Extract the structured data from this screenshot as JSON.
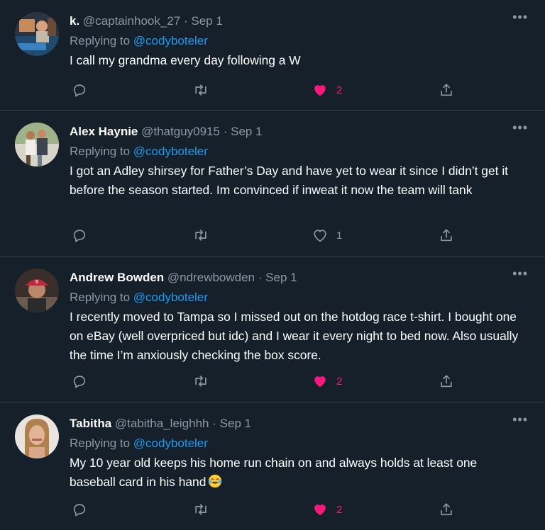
{
  "icons": {
    "reply": "reply-icon",
    "retweet": "retweet-icon",
    "like": "heart-icon",
    "share": "share-icon",
    "more": "more-icon"
  },
  "colors": {
    "background": "#15202b",
    "divider": "#38444d",
    "link": "#1d9bf0",
    "muted": "#8b98a5",
    "liked": "#f91880"
  },
  "tweets": [
    {
      "name": "k.",
      "handle": "@captainhook_27",
      "date": "Sep 1",
      "replying_prefix": "Replying to ",
      "replying_to": "@codyboteler",
      "text": "I call my grandma every day following a W",
      "likes": "2",
      "liked": true
    },
    {
      "name": "Alex Haynie",
      "handle": "@thatguy0915",
      "date": "Sep 1",
      "replying_prefix": "Replying to ",
      "replying_to": "@codyboteler",
      "text": "I got an Adley shirsey for Father’s Day and have yet to wear it since I didn’t get it before the season started. Im convinced if inweat it now the team will tank",
      "likes": "1",
      "liked": false
    },
    {
      "name": "Andrew Bowden",
      "handle": "@ndrewbowden",
      "date": "Sep 1",
      "replying_prefix": "Replying to ",
      "replying_to": "@codyboteler",
      "text": "I recently moved to Tampa so I missed out on the hotdog race t-shirt. I bought one on eBay (well overpriced but idc) and I wear it every night to bed now. Also usually the time I’m anxiously checking the box score.",
      "likes": "2",
      "liked": true
    },
    {
      "name": "Tabitha",
      "handle": "@tabitha_leighhh",
      "date": "Sep 1",
      "replying_prefix": "Replying to ",
      "replying_to": "@codyboteler",
      "text": "My 10 year old keeps his home run chain on and always holds at least one baseball card in his hand",
      "emoji": "tears-of-joy-emoji",
      "likes": "2",
      "liked": true
    }
  ]
}
